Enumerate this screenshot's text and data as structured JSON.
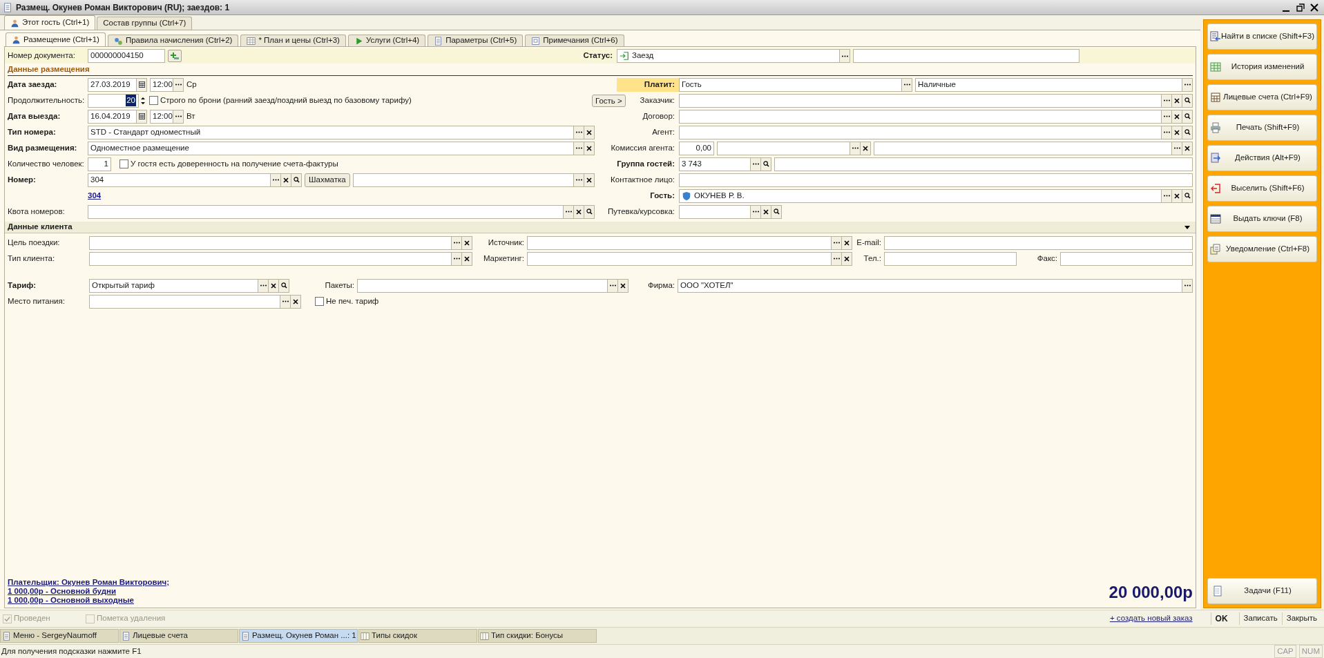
{
  "window": {
    "title": "Размещ. Окунев Роман Викторович (RU); заездов: 1"
  },
  "outer_tabs": [
    {
      "label": "Этот гость (Ctrl+1)",
      "selected": true
    },
    {
      "label": "Состав группы (Ctrl+7)",
      "selected": false
    }
  ],
  "inner_tabs": [
    {
      "label": "Размещение (Ctrl+1)",
      "selected": true
    },
    {
      "label": "Правила начисления (Ctrl+2)",
      "selected": false
    },
    {
      "label": "* План и цены (Ctrl+3)",
      "selected": false
    },
    {
      "label": "Услуги (Ctrl+4)",
      "selected": false
    },
    {
      "label": "Параметры (Ctrl+5)",
      "selected": false
    },
    {
      "label": "Примечания (Ctrl+6)",
      "selected": false
    }
  ],
  "document": {
    "label": "Номер документа:",
    "value": "000000004150"
  },
  "status": {
    "label": "Статус:",
    "value": "Заезд"
  },
  "placement_title": "Данные размещения",
  "left_rows": [
    {
      "kind": "date",
      "label": "Дата заезда:",
      "bold": true,
      "date": "27.03.2019",
      "time": "12:00",
      "weekday": "Ср"
    },
    {
      "kind": "duration",
      "label": "Продолжительность:",
      "bold": false,
      "value": "20",
      "checkbox": {
        "label": "Строго по брони (ранний заезд/поздний выезд по базовому тарифу)",
        "checked": false
      }
    },
    {
      "kind": "date",
      "label": "Дата выезда:",
      "bold": true,
      "date": "16.04.2019",
      "time": "12:00",
      "weekday": "Вт"
    },
    {
      "kind": "ref",
      "label": "Тип номера:",
      "bold": true,
      "value": "STD - Стандарт одноместный"
    },
    {
      "kind": "ref",
      "label": "Вид размещения:",
      "bold": true,
      "value": "Одноместное размещение"
    },
    {
      "kind": "count",
      "label": "Количество человек:",
      "bold": false,
      "value": "1",
      "checkbox": {
        "label": "У гостя есть доверенность на получение счета-фактуры",
        "checked": false
      }
    },
    {
      "kind": "room",
      "label": "Номер:",
      "bold": true,
      "value": "304",
      "button": "Шахматка"
    },
    {
      "kind": "link",
      "link": "304"
    },
    {
      "kind": "ref",
      "label": "Квота номеров:",
      "bold": false
    }
  ],
  "right_rows": [
    {
      "kind": "pays",
      "label": "Платит:",
      "bold": true,
      "highlighted": true,
      "value": "Гость",
      "value2": "Наличные"
    },
    {
      "kind": "ref",
      "label": "Заказчик:",
      "bold": false,
      "side_button": "Гость >"
    },
    {
      "kind": "ref",
      "label": "Договор:",
      "bold": false
    },
    {
      "kind": "ref",
      "label": "Агент:",
      "bold": false
    },
    {
      "kind": "commission",
      "label": "Комиссия агента:",
      "bold": false,
      "value": "0,00"
    },
    {
      "kind": "group",
      "label": "Группа гостей:",
      "bold": true,
      "value": "3 743"
    },
    {
      "kind": "ref",
      "label": "Контактное лицо:",
      "bold": false
    },
    {
      "kind": "ref",
      "label": "Гость:",
      "bold": true,
      "value": "ОКУНЕВ Р. В."
    },
    {
      "kind": "short",
      "label": "Путевка/курсовка:",
      "bold": false
    }
  ],
  "client_title": "Данные клиента",
  "client_rows": [
    [
      {
        "label": "Цель поездки:"
      },
      {
        "label": "Источник:"
      },
      {
        "label": "E-mail:"
      }
    ],
    [
      {
        "label": "Тип клиента:"
      },
      {
        "label": "Маркетинг:"
      },
      {
        "label": "Тел.:"
      },
      {
        "label": "Факс:"
      }
    ]
  ],
  "tariff_rows": [
    [
      {
        "label": "Тариф:",
        "bold": true,
        "value": "Открытый тариф"
      },
      {
        "label": "Пакеты:",
        "bold": false
      },
      {
        "label": "Фирма:",
        "bold": false,
        "value": "ООО \"ХОТЕЛ\""
      }
    ],
    [
      {
        "label": "Место питания:",
        "bold": false
      }
    ]
  ],
  "no_print_tariff": {
    "label": "Не печ. тариф",
    "checked": false
  },
  "footer_links": [
    "Плательщик: Окунев Роман Викторович;",
    "1 000,00р - Основной будни",
    "1 000,00р - Основной выходные"
  ],
  "total": "20 000,00р",
  "actions": [
    {
      "label": "Найти в списке (Shift+F3)"
    },
    {
      "label": "История изменений"
    },
    {
      "label": "Лицевые счета (Ctrl+F9)"
    },
    {
      "label": "Печать (Shift+F9)"
    },
    {
      "label": "Действия (Alt+F9)"
    },
    {
      "label": "Выселить (Shift+F6)"
    },
    {
      "label": "Выдать ключи (F8)"
    },
    {
      "label": "Уведомление (Ctrl+F8)"
    }
  ],
  "tasks_button": {
    "label": "Задачи (F11)"
  },
  "bottom_checks": [
    {
      "label": "Проведен",
      "checked": true,
      "disabled": true
    },
    {
      "label": "Пометка удаления",
      "checked": false,
      "disabled": true
    }
  ],
  "create_link": "+ создать новый заказ",
  "commands": [
    {
      "label": "OK",
      "default": true
    },
    {
      "label": "Записать",
      "default": false
    },
    {
      "label": "Закрыть",
      "default": false
    }
  ],
  "taskbar": [
    {
      "label": "Меню - SergeyNaumoff",
      "selected": false
    },
    {
      "label": "Лицевые счета",
      "selected": false
    },
    {
      "label": "Размещ. Окунев Роман ...: 1",
      "selected": true
    },
    {
      "label": "Типы скидок",
      "selected": false
    },
    {
      "label": "Тип скидки: Бонусы",
      "selected": false
    }
  ],
  "status_bar": {
    "hint": "Для получения подсказки нажмите F1",
    "indicators": [
      "CAP",
      "NUM"
    ]
  }
}
